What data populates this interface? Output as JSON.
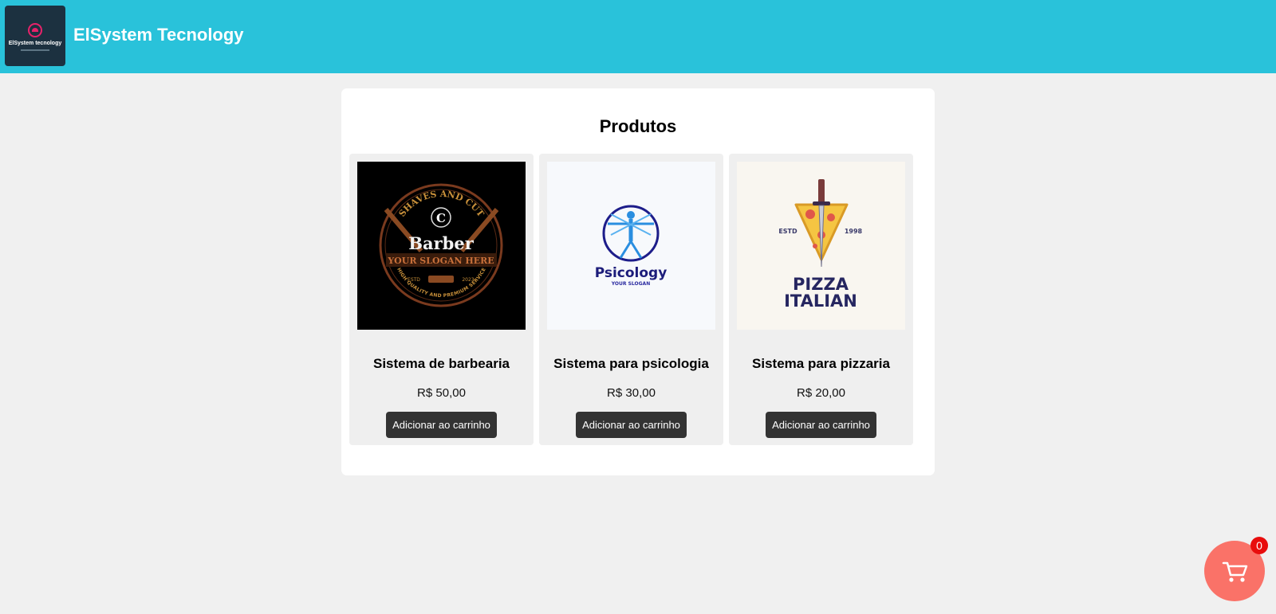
{
  "header": {
    "logo_text": "ElSystem tecnology",
    "brand": "ElSystem Tecnology"
  },
  "main": {
    "title": "Produtos",
    "products": [
      {
        "name": "Sistema de barbearia",
        "price": "R$ 50,00",
        "button": "Adicionar ao carrinho",
        "image": {
          "arc_top": "SHAVES AND CUT",
          "initial": "C",
          "name": "Barber",
          "slogan": "YOUR SLOGAN HERE",
          "estd": "ESTD",
          "year": "2023",
          "arc_bottom": "HIGH QUALITY AND PREMIUM SERVICE"
        }
      },
      {
        "name": "Sistema para psicologia",
        "price": "R$ 30,00",
        "button": "Adicionar ao carrinho",
        "image": {
          "name": "Psicology",
          "slogan": "YOUR SLOGAN"
        }
      },
      {
        "name": "Sistema para pizzaria",
        "price": "R$ 20,00",
        "button": "Adicionar ao carrinho",
        "image": {
          "estd": "ESTD",
          "year": "1998",
          "line1": "PIZZA",
          "line2": "ITALIAN"
        }
      }
    ]
  },
  "cart": {
    "count": "0",
    "icon": "cart-icon"
  },
  "colors": {
    "header": "#29c2da",
    "button": "#333333",
    "cart": "#fa7268",
    "badge": "#e80d0d"
  }
}
